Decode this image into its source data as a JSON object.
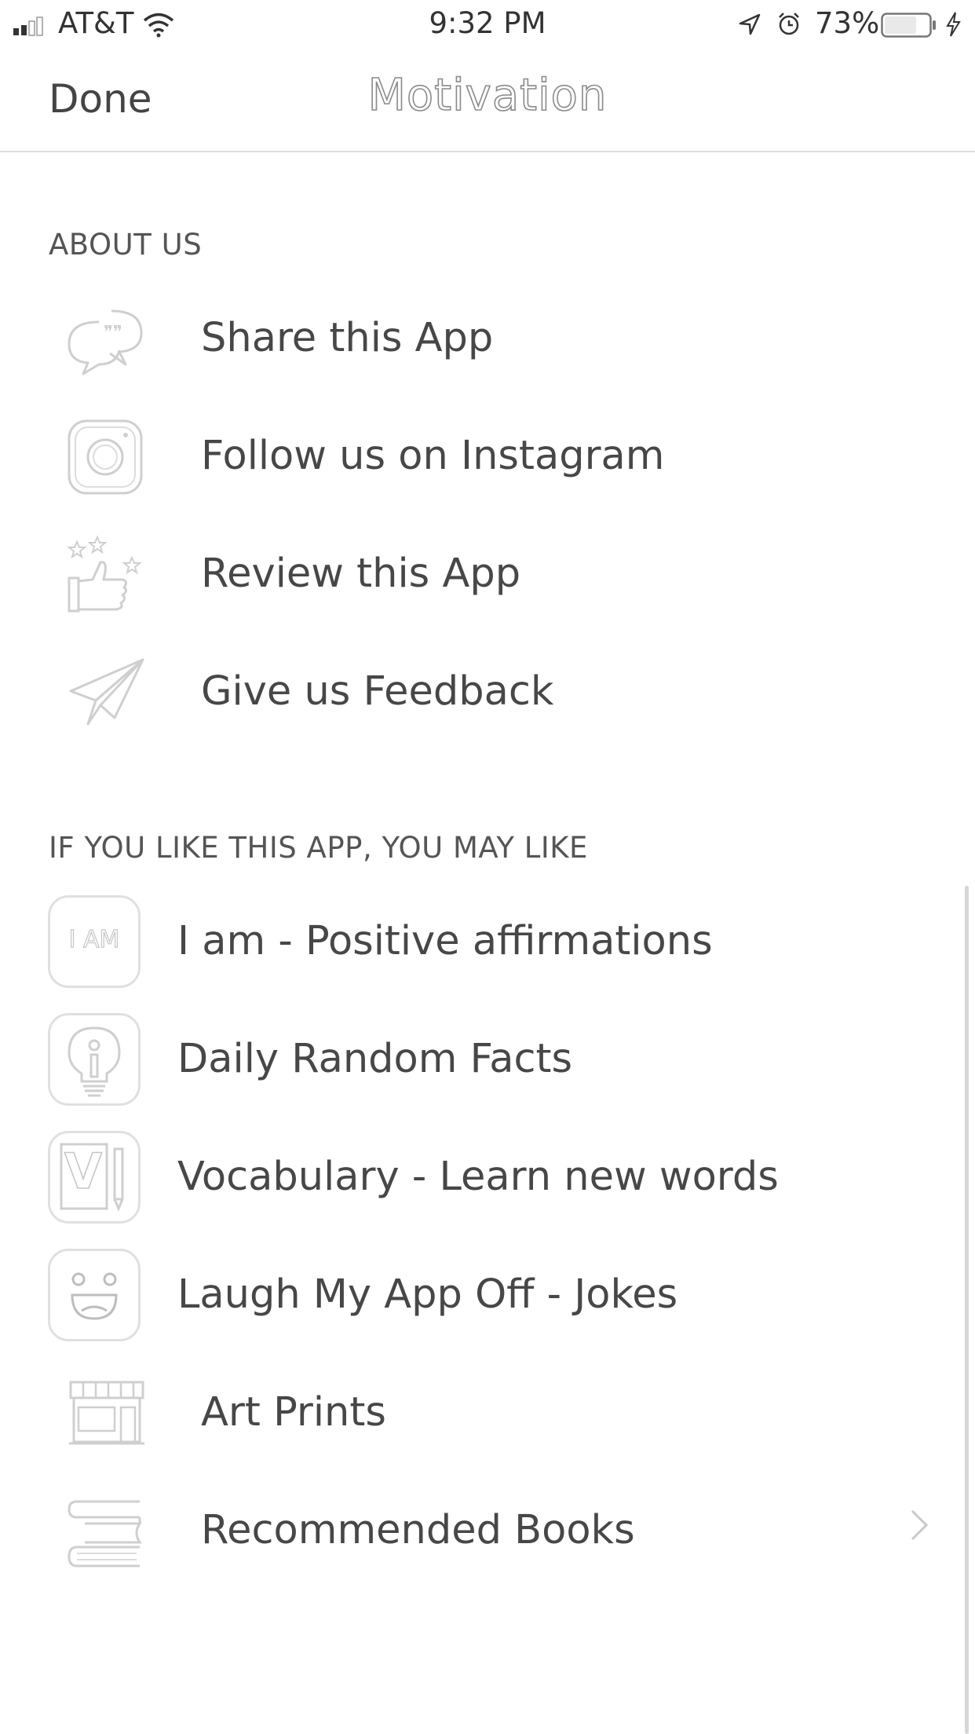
{
  "status_bar": {
    "carrier": "AT&T",
    "time": "9:32 PM",
    "battery": "73%",
    "battery_level": 0.73
  },
  "nav": {
    "done_label": "Done",
    "title": "Motivation"
  },
  "about": {
    "header": "ABOUT US",
    "items": [
      {
        "label": "Share this App",
        "icon": "share-chat-icon"
      },
      {
        "label": "Follow us on Instagram",
        "icon": "instagram-icon"
      },
      {
        "label": "Review this App",
        "icon": "thumbs-up-stars-icon"
      },
      {
        "label": "Give us Feedback",
        "icon": "paper-plane-icon"
      }
    ]
  },
  "recommend": {
    "header": "IF YOU LIKE THIS APP, YOU MAY LIKE",
    "items": [
      {
        "label": "I am - Positive affirmations",
        "icon": "i-am-app-icon",
        "icon_text": "I AM"
      },
      {
        "label": "Daily Random Facts",
        "icon": "lightbulb-app-icon"
      },
      {
        "label": "Vocabulary - Learn new words",
        "icon": "vocabulary-app-icon",
        "icon_text": "V"
      },
      {
        "label": "Laugh My App Off - Jokes",
        "icon": "smiley-app-icon"
      },
      {
        "label": "Art Prints",
        "icon": "storefront-icon"
      },
      {
        "label": "Recommended Books",
        "icon": "books-icon"
      }
    ]
  },
  "colors": {
    "text": "#474747",
    "icon_stroke": "#c8c8c8",
    "divider": "#dedede"
  }
}
